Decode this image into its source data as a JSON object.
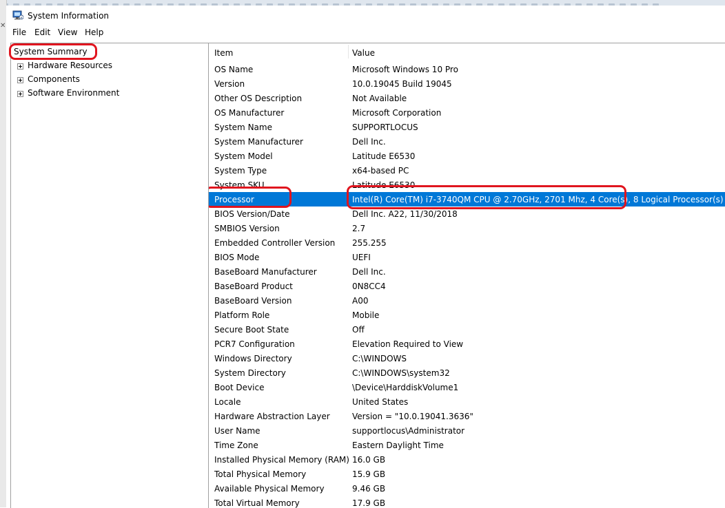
{
  "window": {
    "title": "System Information"
  },
  "menu": {
    "items": [
      "File",
      "Edit",
      "View",
      "Help"
    ]
  },
  "tree": {
    "root": "System Summary",
    "children": [
      "Hardware Resources",
      "Components",
      "Software Environment"
    ]
  },
  "table": {
    "headers": {
      "item": "Item",
      "value": "Value"
    },
    "rows": [
      {
        "item": "OS Name",
        "value": "Microsoft Windows 10 Pro"
      },
      {
        "item": "Version",
        "value": "10.0.19045 Build 19045"
      },
      {
        "item": "Other OS Description",
        "value": "Not Available"
      },
      {
        "item": "OS Manufacturer",
        "value": "Microsoft Corporation"
      },
      {
        "item": "System Name",
        "value": "SUPPORTLOCUS"
      },
      {
        "item": "System Manufacturer",
        "value": "Dell Inc."
      },
      {
        "item": "System Model",
        "value": "Latitude E6530"
      },
      {
        "item": "System Type",
        "value": "x64-based PC"
      },
      {
        "item": "System SKU",
        "value": "Latitude E6530"
      },
      {
        "item": "Processor",
        "value": "Intel(R) Core(TM) i7-3740QM CPU @ 2.70GHz, 2701 Mhz, 4 Core(s), 8 Logical Processor(s)"
      },
      {
        "item": "BIOS Version/Date",
        "value": "Dell Inc. A22, 11/30/2018"
      },
      {
        "item": "SMBIOS Version",
        "value": "2.7"
      },
      {
        "item": "Embedded Controller Version",
        "value": "255.255"
      },
      {
        "item": "BIOS Mode",
        "value": "UEFI"
      },
      {
        "item": "BaseBoard Manufacturer",
        "value": "Dell Inc."
      },
      {
        "item": "BaseBoard Product",
        "value": "0N8CC4"
      },
      {
        "item": "BaseBoard Version",
        "value": "A00"
      },
      {
        "item": "Platform Role",
        "value": "Mobile"
      },
      {
        "item": "Secure Boot State",
        "value": "Off"
      },
      {
        "item": "PCR7 Configuration",
        "value": "Elevation Required to View"
      },
      {
        "item": "Windows Directory",
        "value": "C:\\WINDOWS"
      },
      {
        "item": "System Directory",
        "value": "C:\\WINDOWS\\system32"
      },
      {
        "item": "Boot Device",
        "value": "\\Device\\HarddiskVolume1"
      },
      {
        "item": "Locale",
        "value": "United States"
      },
      {
        "item": "Hardware Abstraction Layer",
        "value": "Version = \"10.0.19041.3636\""
      },
      {
        "item": "User Name",
        "value": "supportlocus\\Administrator"
      },
      {
        "item": "Time Zone",
        "value": "Eastern Daylight Time"
      },
      {
        "item": "Installed Physical Memory (RAM)",
        "value": "16.0 GB"
      },
      {
        "item": "Total Physical Memory",
        "value": "15.9 GB"
      },
      {
        "item": "Available Physical Memory",
        "value": "9.46 GB"
      },
      {
        "item": "Total Virtual Memory",
        "value": "17.9 GB"
      }
    ],
    "selected_row": "Processor"
  },
  "colors": {
    "selection": "#0078d7",
    "annotation": "#e0141e"
  }
}
